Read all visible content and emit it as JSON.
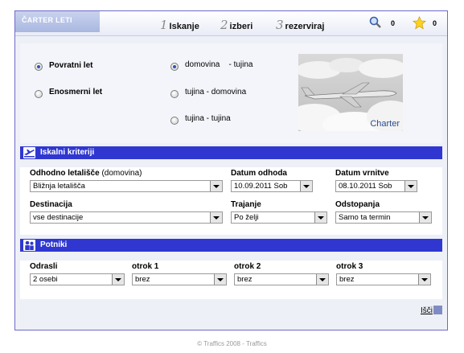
{
  "header": {
    "brand": "ČARTER LETI",
    "steps": [
      {
        "num": "1",
        "label": "Iskanje"
      },
      {
        "num": "2",
        "label": "izberi"
      },
      {
        "num": "3",
        "label": "rezerviraj"
      }
    ],
    "search_count": "0",
    "favorites_count": "0"
  },
  "trip": {
    "return_label": "Povratni let",
    "oneway_label": "Enosmerni let",
    "route_options": [
      "domovina    - tujina",
      "tujina - domovina",
      "tujina - tujina"
    ],
    "image_label": "Charter"
  },
  "criteria": {
    "title": "Iskalni kriteriji",
    "departure_airport_label": "Odhodno letališče",
    "departure_airport_hint": "(domovina)",
    "departure_airport_value": "Bližnja letališča",
    "departure_date_label": "Datum odhoda",
    "departure_date_value": "10.09.2011 Sob",
    "return_date_label": "Datum vrnitve",
    "return_date_value": "08.10.2011 Sob",
    "destination_label": "Destinacija",
    "destination_value": "vse destinacije",
    "duration_label": "Trajanje",
    "duration_value": "Po želji",
    "deviation_label": "Odstopanja",
    "deviation_value": "Samo ta termin"
  },
  "passengers": {
    "title": "Potniki",
    "adults_label": "Odrasli",
    "adults_value": "2 osebi",
    "child1_label": "otrok 1",
    "child1_value": "brez",
    "child2_label": "otrok 2",
    "child2_value": "brez",
    "child3_label": "otrok 3",
    "child3_value": "brez"
  },
  "actions": {
    "search_label": "Išči"
  },
  "footer": "© Traffics 2008 - Traffics"
}
